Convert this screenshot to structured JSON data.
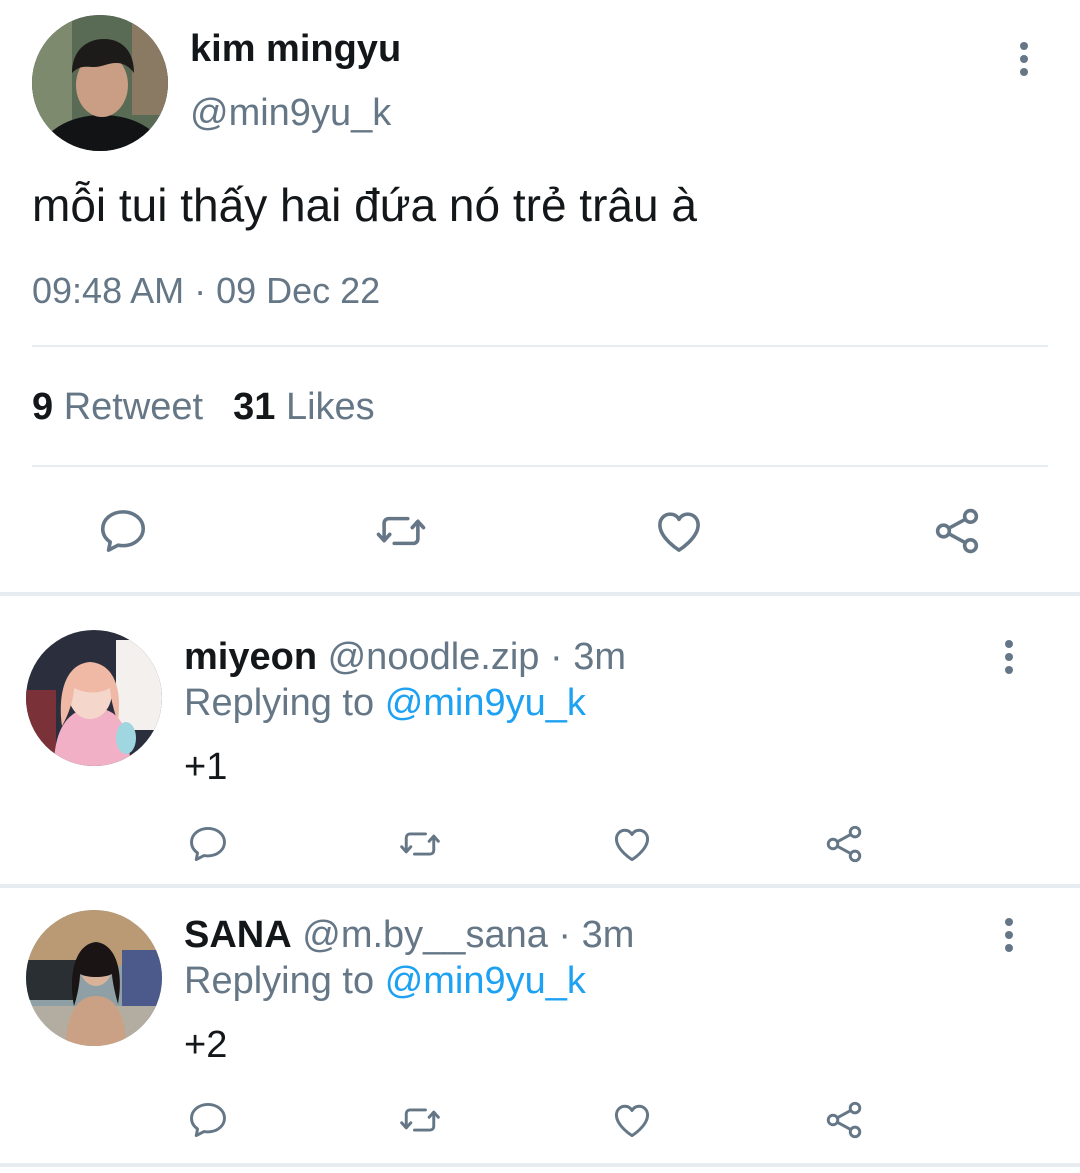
{
  "main_tweet": {
    "display_name": "kim mingyu",
    "handle": "@min9yu_k",
    "text": "mỗi tui thấy hai đứa nó trẻ trâu à",
    "timestamp": "09:48 AM · 09 Dec 22",
    "retweet_count": "9",
    "retweet_label": "Retweet",
    "like_count": "31",
    "like_label": "Likes"
  },
  "replies": [
    {
      "display_name": "miyeon",
      "handle": "@noodle.zip",
      "time": "· 3m",
      "replying_prefix": "Replying to",
      "replying_handle": "@min9yu_k",
      "text": "+1"
    },
    {
      "display_name": "SANA",
      "handle": "@m.by__sana",
      "time": "· 3m",
      "replying_prefix": "Replying to",
      "replying_handle": "@min9yu_k",
      "text": "+2"
    }
  ],
  "icons": {
    "reply": "comment-icon",
    "retweet": "retweet-icon",
    "like": "heart-icon",
    "share": "share-icon",
    "more": "more-vertical-icon"
  },
  "colors": {
    "text": "#14171a",
    "secondary": "#657786",
    "link": "#1da1f2",
    "divider": "#e6ecf0"
  }
}
